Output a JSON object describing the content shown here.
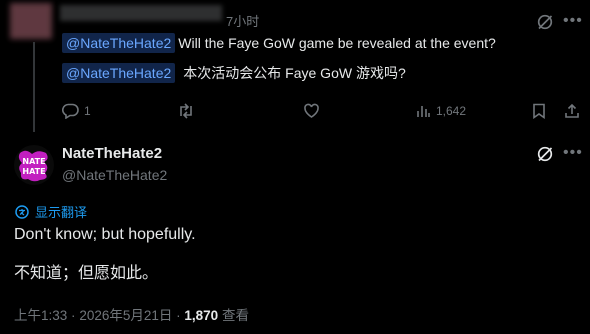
{
  "reply": {
    "time": "7小时",
    "mention": "@NateTheHate2",
    "question_en": "Will the Faye GoW game be revealed at the event?",
    "question_zh": "本次活动会公布 Faye GoW 游戏吗?",
    "reply_count": "1",
    "views": "1,642"
  },
  "main": {
    "display_name": "NateTheHate2",
    "handle": "@NateTheHate2",
    "translate_label": "显示翻译",
    "text_en": "Don't know; but hopefully.",
    "text_zh": "不知道；但愿如此。",
    "time": "上午1:33",
    "date": "2026年5月21日",
    "view_count": "1,870",
    "views_label": "查看",
    "sep": "·"
  },
  "colors": {
    "accent": "#1d9bf0",
    "muted": "#71767b",
    "text": "#e7e9ea",
    "avatar_magenta": "#c21fc0"
  }
}
